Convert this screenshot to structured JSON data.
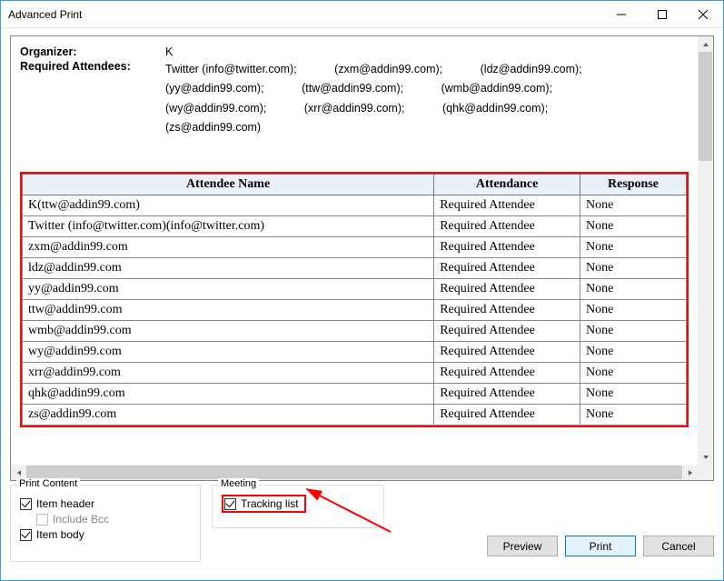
{
  "window": {
    "title": "Advanced Print"
  },
  "meta": {
    "organizer_label": "Organizer:",
    "organizer_value": "K",
    "attendees_label": "Required Attendees:"
  },
  "attendee_flow": [
    "Twitter (info@twitter.com);",
    "(zxm@addin99.com);",
    "(ldz@addin99.com);",
    "(yy@addin99.com);",
    "(ttw@addin99.com);",
    "(wmb@addin99.com);",
    "(wy@addin99.com);",
    "(xrr@addin99.com);",
    "(qhk@addin99.com);",
    "(zs@addin99.com)"
  ],
  "table": {
    "headers": {
      "name": "Attendee Name",
      "attendance": "Attendance",
      "response": "Response"
    },
    "rows": [
      {
        "name": "K(ttw@addin99.com)",
        "attendance": "Required Attendee",
        "response": "None"
      },
      {
        "name": "Twitter (info@twitter.com)(info@twitter.com)",
        "attendance": "Required Attendee",
        "response": "None"
      },
      {
        "name": "zxm@addin99.com",
        "attendance": "Required Attendee",
        "response": "None"
      },
      {
        "name": "ldz@addin99.com",
        "attendance": "Required Attendee",
        "response": "None"
      },
      {
        "name": "yy@addin99.com",
        "attendance": "Required Attendee",
        "response": "None"
      },
      {
        "name": "ttw@addin99.com",
        "attendance": "Required Attendee",
        "response": "None"
      },
      {
        "name": "wmb@addin99.com",
        "attendance": "Required Attendee",
        "response": "None"
      },
      {
        "name": "wy@addin99.com",
        "attendance": "Required Attendee",
        "response": "None"
      },
      {
        "name": "xrr@addin99.com",
        "attendance": "Required Attendee",
        "response": "None"
      },
      {
        "name": "qhk@addin99.com",
        "attendance": "Required Attendee",
        "response": "None"
      },
      {
        "name": "zs@addin99.com",
        "attendance": "Required Attendee",
        "response": "None"
      }
    ]
  },
  "groups": {
    "print_content_label": "Print Content",
    "item_header": "Item header",
    "include_bcc": "Include Bcc",
    "item_body": "Item body",
    "meeting_label": "Meeting",
    "tracking_list": "Tracking list"
  },
  "buttons": {
    "preview": "Preview",
    "print": "Print",
    "cancel": "Cancel"
  }
}
